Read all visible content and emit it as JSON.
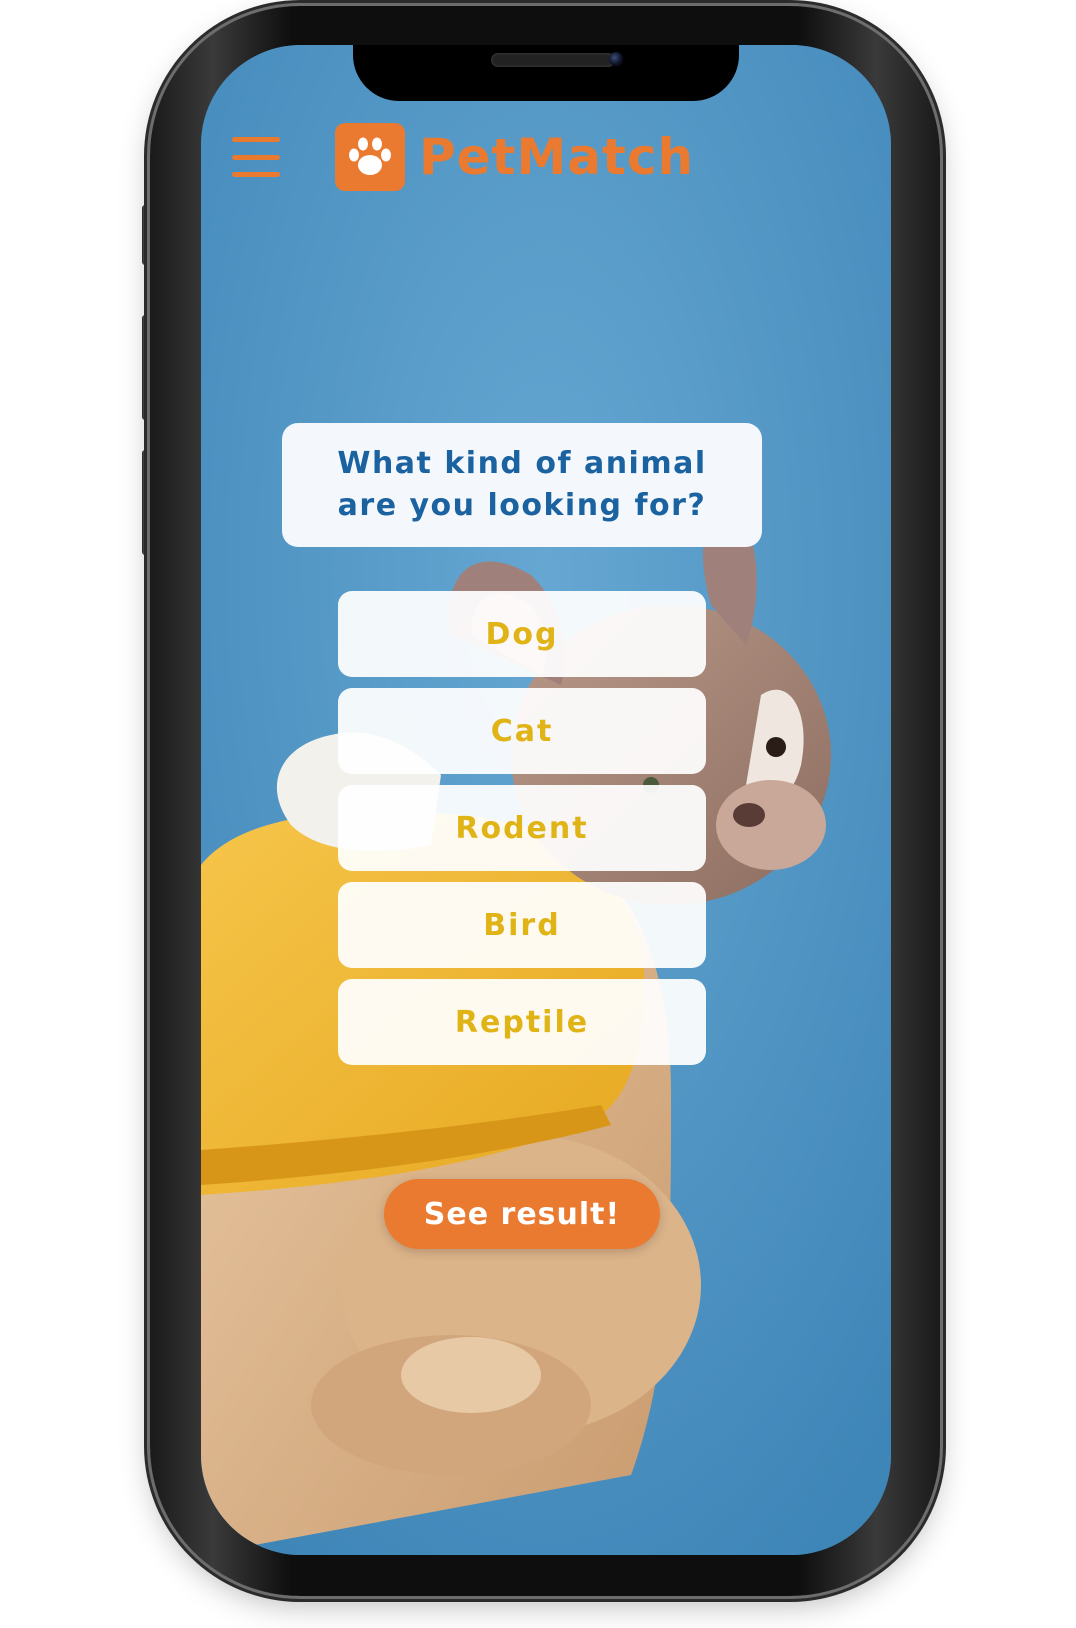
{
  "app": {
    "name": "PetMatch",
    "logo_icon": "paw-icon",
    "menu_icon": "hamburger-menu-icon"
  },
  "quiz": {
    "question": "What kind of animal are you looking for?",
    "options": [
      {
        "label": "Dog"
      },
      {
        "label": "Cat"
      },
      {
        "label": "Rodent"
      },
      {
        "label": "Bird"
      },
      {
        "label": "Reptile"
      }
    ],
    "submit_label": "See result!"
  },
  "colors": {
    "brand_orange": "#ea7a30",
    "question_text": "#1b62a0",
    "option_text": "#e0b316",
    "background_blue": "#4d95c4",
    "dog_sweater": "#f1b72a"
  },
  "background": {
    "description_icon": "french-bulldog-photo"
  }
}
